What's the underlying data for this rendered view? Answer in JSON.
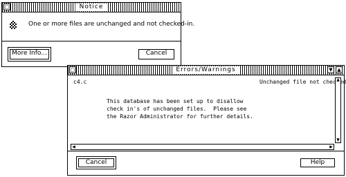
{
  "notice": {
    "title": "Notice",
    "message": "One or more files are unchanged and not checked-in.",
    "more_info_label": "More Info...",
    "cancel_label": "Cancel"
  },
  "errors": {
    "title": "Errors/Warnings",
    "file_name": "c4.c",
    "status": "Unchanged file not checked in.",
    "detail_lines": [
      "This database has been set up to disallow",
      "check in's of unchanged files.  Please see",
      "the Razor Administrator for further details."
    ],
    "cancel_label": "Cancel",
    "help_label": "Help"
  }
}
